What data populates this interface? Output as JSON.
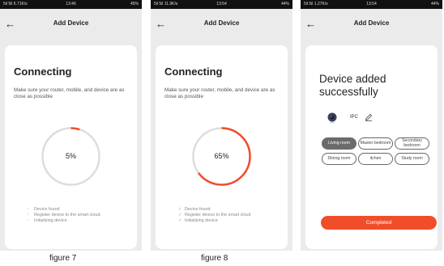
{
  "colors": {
    "accent": "#f04e2a",
    "track": "#dddddd",
    "check": "#7cbf5a",
    "selected_room": "#6b6b6b"
  },
  "header": {
    "back_icon": "arrow-left-icon",
    "title": "Add Device"
  },
  "screens": [
    {
      "status": {
        "left": "5il 5il 6.71K/s",
        "time": "13:46",
        "right": "45%"
      },
      "heading": "Connecting",
      "subtext": "Make sure your router, mobile, and device are as close as possible",
      "progress": {
        "percent": 5,
        "label": "5%"
      },
      "steps": [
        {
          "label": "Device found",
          "done": false
        },
        {
          "label": "Register device to the smart cloud.",
          "done": false
        },
        {
          "label": "Initializing device",
          "done": false
        }
      ]
    },
    {
      "status": {
        "left": "5il 5il 11.9K/s",
        "time": "13:54",
        "right": "44%"
      },
      "heading": "Connecting",
      "subtext": "Make sure your router, mobile, and device are as close as possible",
      "progress": {
        "percent": 65,
        "label": "65%"
      },
      "steps": [
        {
          "label": "Device found",
          "done": true
        },
        {
          "label": "Register device to the smart cloud",
          "done": true
        },
        {
          "label": "Initializing device",
          "done": true
        }
      ]
    },
    {
      "status": {
        "left": "5il 5il 1.27K/s",
        "time": "13:54",
        "right": "44%"
      },
      "heading": "Device added successfully",
      "device": {
        "icon": "camera-icon",
        "name": "IPC",
        "edit_icon": "pencil-icon"
      },
      "rooms": [
        {
          "label": "Living room",
          "selected": true
        },
        {
          "label": "Master bedroom",
          "selected": false
        },
        {
          "label": "Secondary bedroom",
          "selected": false
        },
        {
          "label": "Dining room",
          "selected": false
        },
        {
          "label": "itchen",
          "selected": false
        },
        {
          "label": "Study room",
          "selected": false
        }
      ],
      "button": "Completed"
    }
  ],
  "captions": [
    "figure 7",
    "figure 8"
  ]
}
